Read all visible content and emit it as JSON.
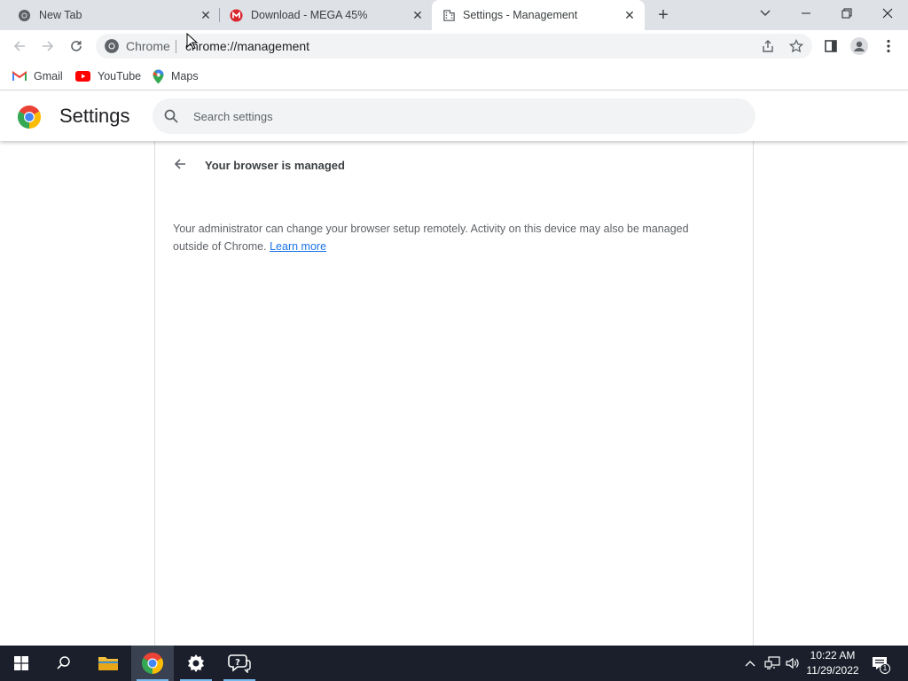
{
  "tabs": [
    {
      "title": "New Tab",
      "icon": "chrome-icon",
      "active": false
    },
    {
      "title": "Download - MEGA 45%",
      "icon": "mega-icon",
      "active": false
    },
    {
      "title": "Settings - Management",
      "icon": "building-icon",
      "active": true
    }
  ],
  "toolbar": {
    "site_label": "Chrome",
    "url": "chrome://management"
  },
  "bookmarks": [
    {
      "label": "Gmail",
      "icon": "gmail-icon"
    },
    {
      "label": "YouTube",
      "icon": "youtube-icon"
    },
    {
      "label": "Maps",
      "icon": "maps-icon"
    }
  ],
  "settings": {
    "title": "Settings",
    "search_placeholder": "Search settings"
  },
  "management": {
    "heading": "Your browser is managed",
    "description": "Your administrator can change your browser setup remotely. Activity on this device may also be managed outside of Chrome.",
    "learn_more": "Learn more"
  },
  "taskbar": {
    "time": "10:22 AM",
    "date": "11/29/2022",
    "notifications": "1"
  },
  "colors": {
    "link": "#1a73e8",
    "tabstrip": "#dee1e6",
    "taskbar": "#1a1f2b"
  }
}
